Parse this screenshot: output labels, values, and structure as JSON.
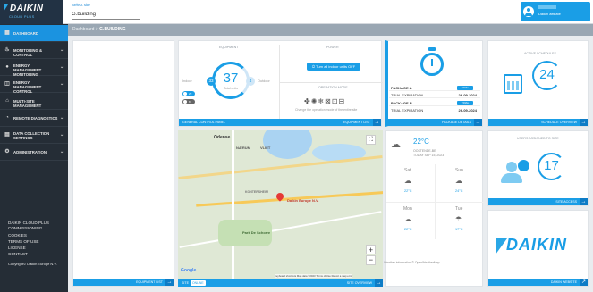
{
  "brand": {
    "name": "DAIKIN",
    "sub": "CLOUD PLUS"
  },
  "site": {
    "label": "Select site",
    "value": "G.building"
  },
  "user": {
    "role": "Daikin affiliate",
    "avatar_icon": "user-icon"
  },
  "breadcrumb": {
    "root": "Dashboard",
    "sep": ">",
    "current": "G.BUILDING"
  },
  "sidebar": {
    "items": [
      {
        "label": "Dashboard",
        "icon": "grid-icon",
        "chevron": false,
        "active": true
      },
      {
        "label": "Monitoring & Control",
        "icon": "thermometer-icon",
        "chevron": true
      },
      {
        "label": "Energy Management Monitoring",
        "icon": "energy-icon",
        "chevron": true
      },
      {
        "label": "Energy Management Control",
        "icon": "chart-icon",
        "chevron": true
      },
      {
        "label": "Multi-Site Management",
        "icon": "sites-icon",
        "chevron": false
      },
      {
        "label": "Remote Diagnostics",
        "icon": "diagnostics-icon",
        "chevron": true
      },
      {
        "label": "Data Collection Settings",
        "icon": "data-icon",
        "chevron": true
      },
      {
        "label": "Administration",
        "icon": "gear-icon",
        "chevron": true
      }
    ],
    "footer_links": [
      "DAIKIN CLOUD PLUS COMMISSIONING",
      "COOKIES",
      "TERMS OF USE",
      "LICENSE",
      "CONTACT"
    ],
    "copyright": "Copyright© Daikin Europe N.V."
  },
  "equipment_card": {
    "footer": "Equipment list"
  },
  "general_control": {
    "equipment_title": "Equipment",
    "indoor_label": "Indoor",
    "outdoor_label": "Outdoor",
    "indoor_count": "33",
    "total_count": "37",
    "total_label": "Total units",
    "outdoor_count": "4",
    "on_label": "29 ON",
    "off_label": "8 OFF",
    "power_title": "Power",
    "power_button": "Turn all indoor units OFF",
    "mode_title": "Operation mode",
    "mode_caption": "Change the operation mode of the entire site",
    "footer_left": "General control panel",
    "footer_right": "Equipment list"
  },
  "packages": {
    "rows": [
      {
        "key": "PACKAGE A",
        "badge": "TRIAL"
      },
      {
        "key": "TRIAL EXPIRATION",
        "value": "26-09-2024"
      },
      {
        "key": "PACKAGE B",
        "badge": "TRIAL"
      },
      {
        "key": "TRIAL EXPIRATION",
        "value": "26-09-2024"
      }
    ],
    "footer": "Package details"
  },
  "schedules": {
    "title": "Active schedules",
    "count": "24",
    "footer": "Schedule overview"
  },
  "users": {
    "title": "Users assigned to site",
    "count": "17",
    "footer": "Site access"
  },
  "map": {
    "labels": {
      "odense": "Odense",
      "naerum": "NÆRUM",
      "daikin": "Daikin Europe N.V.",
      "park": "Park De Schorre",
      "vliet": "VLIET",
      "kontersheim": "KONTERSHEIM"
    },
    "zoom_in": "+",
    "zoom_out": "−",
    "google": "Google",
    "attribution": "Keyboard shortcuts   Map data ©2023   Terms of Use   Report a map error",
    "footer_left": "Site",
    "status": "ONLINE",
    "footer_right": "Site overview"
  },
  "weather": {
    "current_temp": "22°C",
    "place": "OOSTENDE-BE",
    "date": "TODAY SEP 15, 2023",
    "days": [
      {
        "name": "Sat",
        "temp": "22°C"
      },
      {
        "name": "Sun",
        "temp": "24°C"
      },
      {
        "name": "Mon",
        "temp": "22°C"
      },
      {
        "name": "Tue",
        "temp": "17°C"
      }
    ],
    "credit": "Weather information © OpenWeatherMap"
  },
  "daikin_card": {
    "brand": "DAIKIN",
    "footer": "Daikin website"
  },
  "colors": {
    "accent": "#1a9ee6",
    "sidebar": "#252d36",
    "on": "#1a9ee6",
    "off": "#666666"
  }
}
